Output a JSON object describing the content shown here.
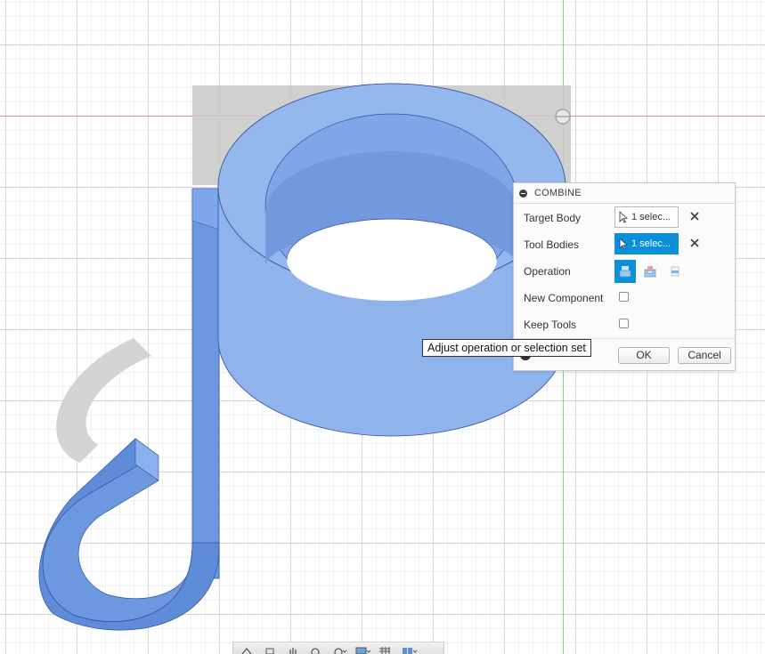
{
  "dialog": {
    "title": "COMBINE",
    "target_body": {
      "label": "Target Body",
      "selection": "1 selec..."
    },
    "tool_bodies": {
      "label": "Tool Bodies",
      "selection": "1 selec..."
    },
    "operation": {
      "label": "Operation",
      "options": [
        "join-icon",
        "cut-icon",
        "intersect-icon"
      ],
      "selected": "join"
    },
    "new_component": {
      "label": "New Component",
      "checked": false
    },
    "keep_tools": {
      "label": "Keep Tools",
      "checked": false
    },
    "ok_label": "OK",
    "cancel_label": "Cancel"
  },
  "tooltip": {
    "text": "Adjust operation or selection set"
  },
  "colors": {
    "body_fill": "#8fb4ec",
    "body_dark": "#6c98e0",
    "active_blue": "#0b8fd8",
    "x_axis": "#e68f8f",
    "y_axis": "#8fd08f"
  },
  "toolbar": {
    "icons": [
      "orbit-icon",
      "look-at-icon",
      "pan-icon",
      "zoom-icon",
      "fit-icon",
      "display-settings-icon",
      "grid-icon",
      "viewports-icon"
    ]
  }
}
